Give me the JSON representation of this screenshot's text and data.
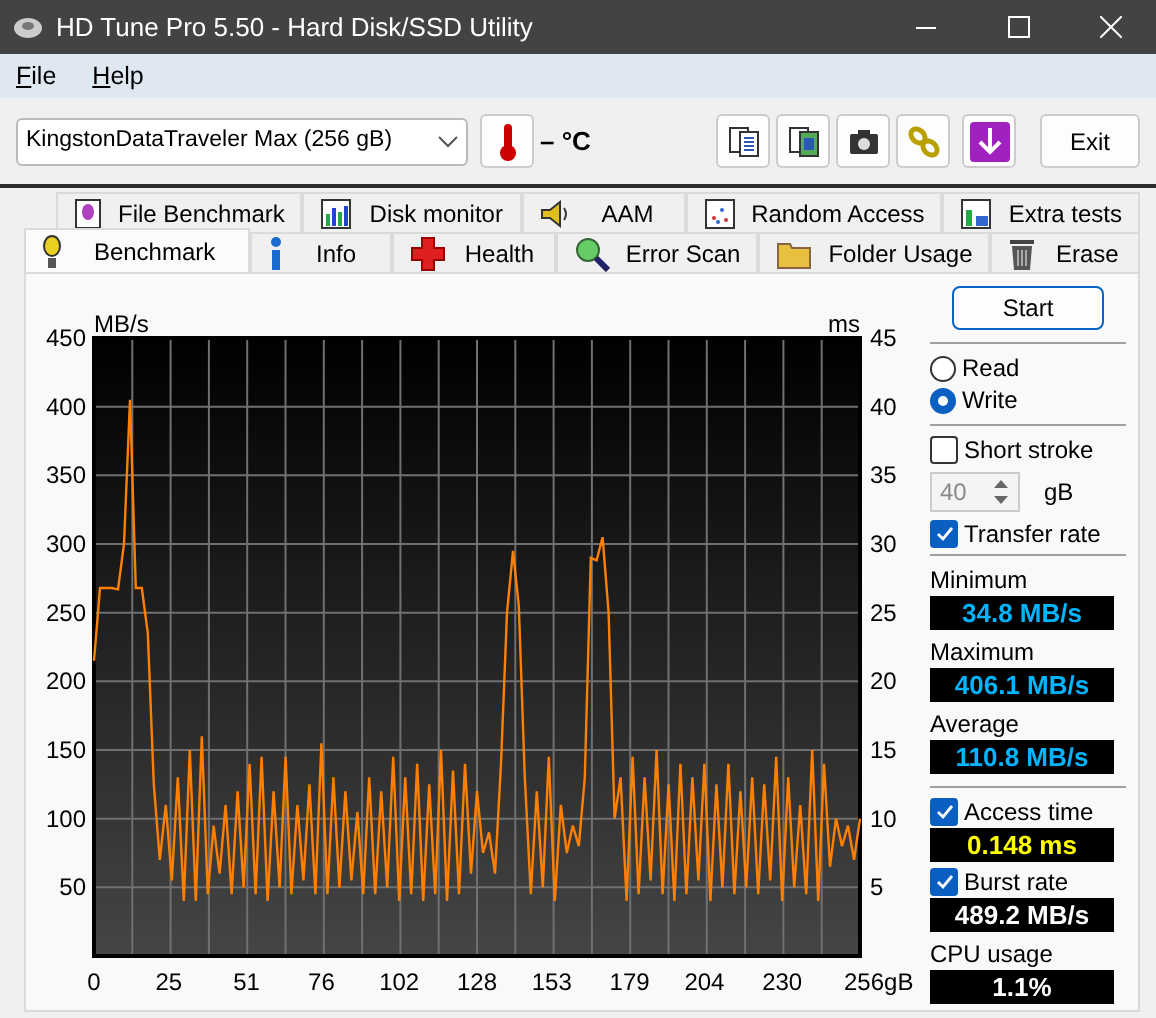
{
  "window": {
    "title": "HD Tune Pro 5.50 - Hard Disk/SSD Utility"
  },
  "menu": [
    {
      "label": "File"
    },
    {
      "label": "Help"
    }
  ],
  "toolbar": {
    "drive": "KingstonDataTraveler Max (256 gB)",
    "temperature": "– °C",
    "exit_button": "Exit"
  },
  "tabs": [
    [
      {
        "label": "File Benchmark",
        "selected": false
      },
      {
        "label": "Disk monitor",
        "selected": false
      },
      {
        "label": "AAM",
        "selected": false
      },
      {
        "label": "Random Access",
        "selected": false
      },
      {
        "label": "Extra tests",
        "selected": false
      }
    ],
    [
      {
        "label": "Benchmark",
        "selected": true
      },
      {
        "label": "Info",
        "selected": false
      },
      {
        "label": "Health",
        "selected": false
      },
      {
        "label": "Error Scan",
        "selected": false
      },
      {
        "label": "Folder Usage",
        "selected": false
      },
      {
        "label": "Erase",
        "selected": false
      }
    ]
  ],
  "chart": {
    "right_axis_label": "ms",
    "right_ticks": [
      "45",
      "40",
      "35",
      "30",
      "25",
      "20",
      "15",
      "10",
      "5"
    ],
    "chart_data": {
      "type": "line",
      "ylabel": "MB/s",
      "xlim": [
        0,
        256
      ],
      "ylim": [
        0,
        450
      ],
      "grid": true,
      "xticks": [
        0,
        25,
        51,
        76,
        102,
        128,
        153,
        179,
        204,
        230,
        {
          "value": 256,
          "label": "256gB"
        }
      ],
      "yticks": [
        50,
        100,
        150,
        200,
        250,
        300,
        350,
        400,
        450
      ],
      "x": [
        0,
        2,
        4,
        6,
        8,
        10,
        12,
        14,
        16,
        18,
        20,
        22,
        24,
        26,
        28,
        30,
        32,
        34,
        36,
        38,
        40,
        42,
        44,
        46,
        48,
        50,
        52,
        54,
        56,
        58,
        60,
        62,
        64,
        66,
        68,
        70,
        72,
        74,
        76,
        78,
        80,
        82,
        84,
        86,
        88,
        90,
        92,
        94,
        96,
        98,
        100,
        102,
        104,
        106,
        108,
        110,
        112,
        114,
        116,
        118,
        120,
        122,
        124,
        126,
        128,
        130,
        132,
        134,
        136,
        138,
        140,
        142,
        144,
        146,
        148,
        150,
        152,
        154,
        156,
        158,
        160,
        162,
        164,
        166,
        168,
        170,
        172,
        174,
        176,
        178,
        180,
        182,
        184,
        186,
        188,
        190,
        192,
        194,
        196,
        198,
        200,
        202,
        204,
        206,
        208,
        210,
        212,
        214,
        216,
        218,
        220,
        222,
        224,
        226,
        228,
        230,
        232,
        234,
        236,
        238,
        240,
        242,
        244,
        246,
        248,
        250,
        252,
        254,
        256
      ],
      "series": [
        {
          "color": "#ff8000",
          "values": [
            215,
            268,
            268,
            268,
            267,
            300,
            405,
            268,
            268,
            235,
            125,
            70,
            110,
            55,
            130,
            40,
            150,
            40,
            160,
            45,
            95,
            60,
            110,
            45,
            120,
            50,
            140,
            45,
            145,
            40,
            120,
            50,
            145,
            45,
            110,
            55,
            125,
            45,
            155,
            45,
            130,
            50,
            120,
            55,
            105,
            45,
            130,
            45,
            120,
            50,
            145,
            40,
            130,
            45,
            140,
            40,
            125,
            45,
            150,
            40,
            135,
            45,
            140,
            60,
            120,
            75,
            90,
            60,
            140,
            250,
            295,
            255,
            130,
            45,
            120,
            50,
            145,
            40,
            110,
            75,
            95,
            80,
            130,
            290,
            288,
            305,
            250,
            100,
            130,
            40,
            145,
            45,
            130,
            55,
            150,
            45,
            125,
            40,
            140,
            45,
            130,
            55,
            140,
            40,
            125,
            50,
            140,
            45,
            120,
            50,
            130,
            45,
            125,
            55,
            145,
            40,
            130,
            50,
            110,
            45,
            150,
            40,
            140,
            65,
            100,
            80,
            95,
            70,
            100
          ]
        }
      ]
    }
  },
  "controls": {
    "start_button": "Start",
    "modes": [
      {
        "label": "Read",
        "selected": false
      },
      {
        "label": "Write",
        "selected": true
      }
    ],
    "short_stroke": {
      "label": "Short stroke",
      "checked": false,
      "value": "40",
      "disabled": true,
      "unit": "gB"
    },
    "transfer_rate": {
      "label": "Transfer rate",
      "checked": true
    },
    "stats": [
      {
        "label": "Minimum",
        "value": "34.8 MB/s",
        "color": "#00b4ff"
      },
      {
        "label": "Maximum",
        "value": "406.1 MB/s",
        "color": "#00b4ff"
      },
      {
        "label": "Average",
        "value": "110.8 MB/s",
        "color": "#00b4ff"
      }
    ],
    "access_time": {
      "label": "Access time",
      "checked": true,
      "value": "0.148 ms",
      "color": "#ffff00"
    },
    "burst_rate": {
      "label": "Burst rate",
      "checked": true,
      "value": "489.2 MB/s",
      "color": "#ffffff"
    },
    "cpu_usage": {
      "label": "CPU usage",
      "value": "1.1%",
      "color": "#ffffff"
    }
  }
}
